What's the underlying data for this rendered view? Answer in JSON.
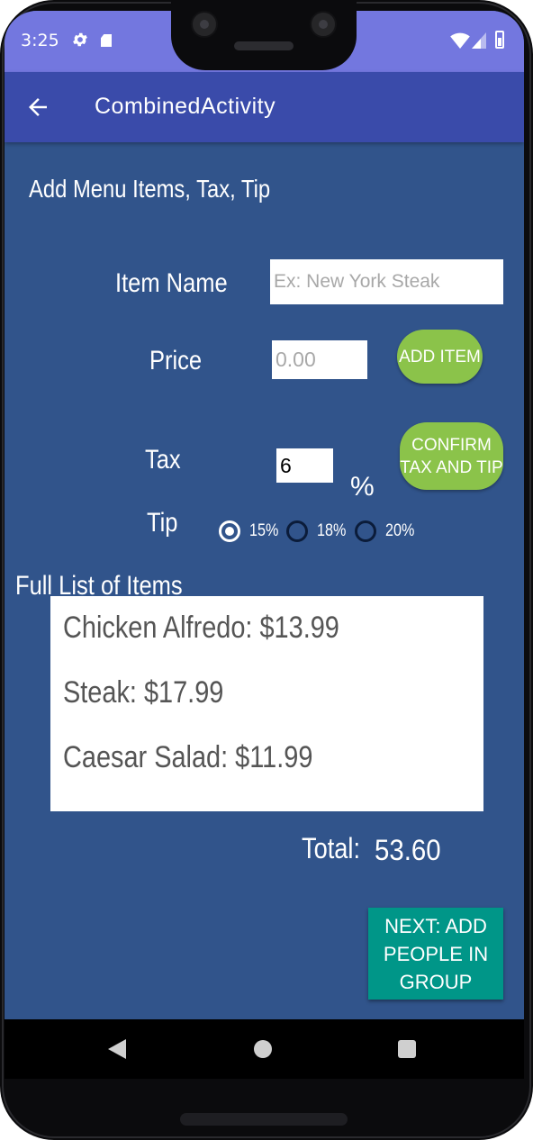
{
  "status_bar": {
    "time": "3:25"
  },
  "app_bar": {
    "title": "CombinedActivity"
  },
  "form": {
    "heading": "Add Menu Items, Tax, Tip",
    "item_name_label": "Item Name",
    "item_name_placeholder": "Ex: New York Steak",
    "price_label": "Price",
    "price_placeholder": "0.00",
    "add_item_button": "ADD ITEM",
    "tax_label": "Tax",
    "tax_value": "6",
    "percent_symbol": "%",
    "confirm_button": "CONFIRM TAX AND TIP",
    "tip_label": "Tip",
    "tip_options": [
      {
        "label": "15%",
        "selected": true
      },
      {
        "label": "18%",
        "selected": false
      },
      {
        "label": "20%",
        "selected": false
      }
    ]
  },
  "items_list": {
    "heading": "Full List of Items",
    "items": [
      "Chicken Alfredo: $13.99",
      "Steak: $17.99",
      "Caesar Salad: $11.99"
    ]
  },
  "total": {
    "label": "Total:",
    "value": "53.60"
  },
  "next_button": "NEXT: ADD PEOPLE IN GROUP",
  "colors": {
    "background": "#31548b",
    "app_bar": "#3a4baa",
    "status_bar": "#7377df",
    "pill_button": "#8bc34a",
    "next_button": "#009688"
  }
}
